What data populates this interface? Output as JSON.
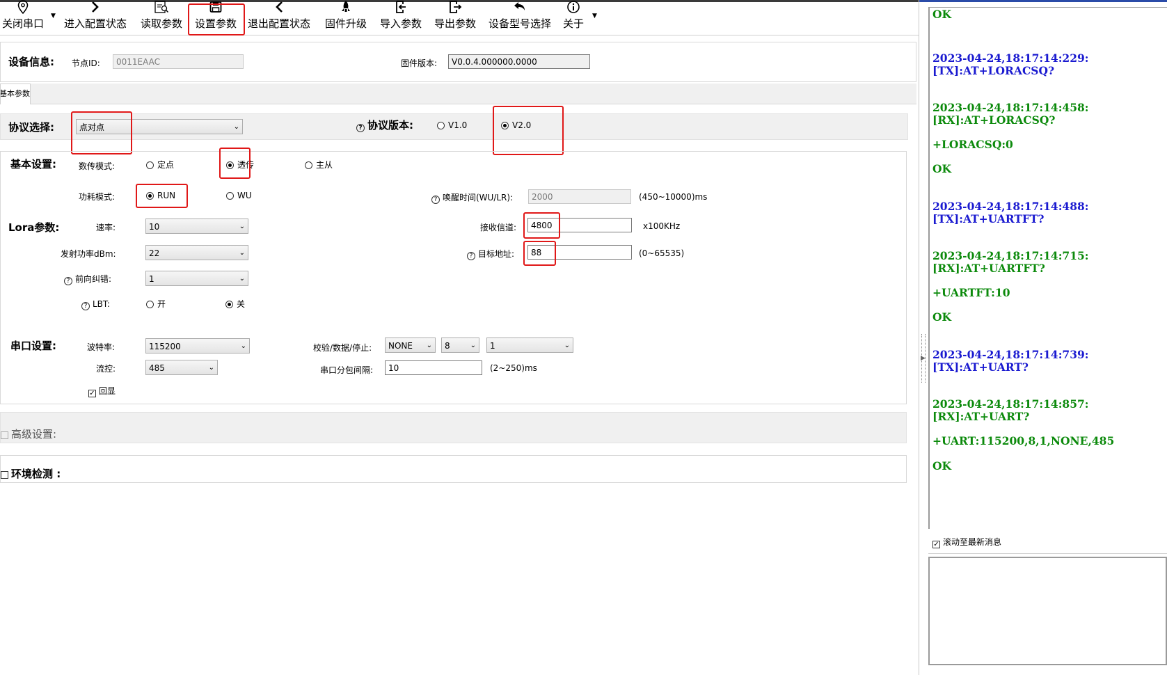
{
  "toolbar": {
    "items": [
      {
        "label": "关闭串口",
        "icon": "location-pin-icon"
      },
      {
        "label": "进入配置状态",
        "icon": "chevron-right-icon"
      },
      {
        "label": "读取参数",
        "icon": "read-search-icon"
      },
      {
        "label": "设置参数",
        "icon": "save-icon"
      },
      {
        "label": "退出配置状态",
        "icon": "chevron-left-icon"
      },
      {
        "label": "固件升级",
        "icon": "rocket-icon"
      },
      {
        "label": "导入参数",
        "icon": "import-icon"
      },
      {
        "label": "导出参数",
        "icon": "export-icon"
      },
      {
        "label": "设备型号选择",
        "icon": "undo-arrow-icon"
      },
      {
        "label": "关于",
        "icon": "info-icon"
      }
    ]
  },
  "device_info": {
    "title": "设备信息:",
    "node_id_label": "节点ID:",
    "node_id_value": "0011EAAC",
    "firmware_label": "固件版本:",
    "firmware_value": "V0.0.4.000000.0000"
  },
  "tab": {
    "label": "基本参数"
  },
  "protocol": {
    "label": "协议选择:",
    "selected": "点对点",
    "version_label": "协议版本:",
    "v1": "V1.0",
    "v2": "V2.0",
    "version_selected": "V2.0"
  },
  "basic": {
    "title": "基本设置:",
    "mode_label": "数传模式:",
    "mode_options": [
      "定点",
      "透传",
      "主从"
    ],
    "mode_selected": "透传",
    "power_label": "功耗模式:",
    "power_options": [
      "RUN",
      "WU"
    ],
    "power_selected": "RUN",
    "wake_label": "唤醒时间(WU/LR):",
    "wake_value": "2000",
    "wake_range": "(450~10000)ms"
  },
  "lora": {
    "title": "Lora参数:",
    "rate_label": "速率:",
    "rate_value": "10",
    "tx_power_label": "发射功率dBm:",
    "tx_power_value": "22",
    "fec_label": "前向纠错:",
    "fec_value": "1",
    "lbt_label": "LBT:",
    "lbt_on": "开",
    "lbt_off": "关",
    "lbt_selected": "关",
    "rx_channel_label": "接收信道:",
    "rx_channel_value": "4800",
    "rx_channel_unit": "x100KHz",
    "target_addr_label": "目标地址:",
    "target_addr_value": "88",
    "target_addr_range": "(0~65535)"
  },
  "serial": {
    "title": "串口设置:",
    "baud_label": "波特率:",
    "baud_value": "115200",
    "flow_label": "流控:",
    "flow_value": "485",
    "echo_label": "回显",
    "echo_checked": true,
    "check_label": "校验/数据/停止:",
    "parity_value": "NONE",
    "data_bits_value": "8",
    "stop_bits_value": "1",
    "interval_label": "串口分包间隔:",
    "interval_value": "10",
    "interval_range": "(2~250)ms"
  },
  "advanced": {
    "label": "高级设置:"
  },
  "env": {
    "label": "环境检测 :"
  },
  "log": {
    "lines": [
      {
        "text": "OK",
        "type": "rx"
      },
      {
        "text": "2023-04-24,18:17:14:229:",
        "type": "tx"
      },
      {
        "text": "[TX]:AT+LORACSQ?",
        "type": "tx"
      },
      {
        "text": "2023-04-24,18:17:14:458:",
        "type": "rx"
      },
      {
        "text": "[RX]:AT+LORACSQ?",
        "type": "rx"
      },
      {
        "text": "+LORACSQ:0",
        "type": "rx"
      },
      {
        "text": "OK",
        "type": "rx"
      },
      {
        "text": "2023-04-24,18:17:14:488:",
        "type": "tx"
      },
      {
        "text": "[TX]:AT+UARTFT?",
        "type": "tx"
      },
      {
        "text": "2023-04-24,18:17:14:715:",
        "type": "rx"
      },
      {
        "text": "[RX]:AT+UARTFT?",
        "type": "rx"
      },
      {
        "text": "+UARTFT:10",
        "type": "rx"
      },
      {
        "text": "OK",
        "type": "rx"
      },
      {
        "text": "2023-04-24,18:17:14:739:",
        "type": "tx"
      },
      {
        "text": "[TX]:AT+UART?",
        "type": "tx"
      },
      {
        "text": "2023-04-24,18:17:14:857:",
        "type": "rx"
      },
      {
        "text": "[RX]:AT+UART?",
        "type": "rx"
      },
      {
        "text": "+UART:115200,8,1,NONE,485",
        "type": "rx"
      },
      {
        "text": "OK",
        "type": "rx"
      }
    ],
    "scroll_label": "滚动至最新消息",
    "scroll_checked": true
  },
  "colors": {
    "tx": "#1a1ad0",
    "rx": "#0c8a0c",
    "highlight": "#e01818"
  }
}
